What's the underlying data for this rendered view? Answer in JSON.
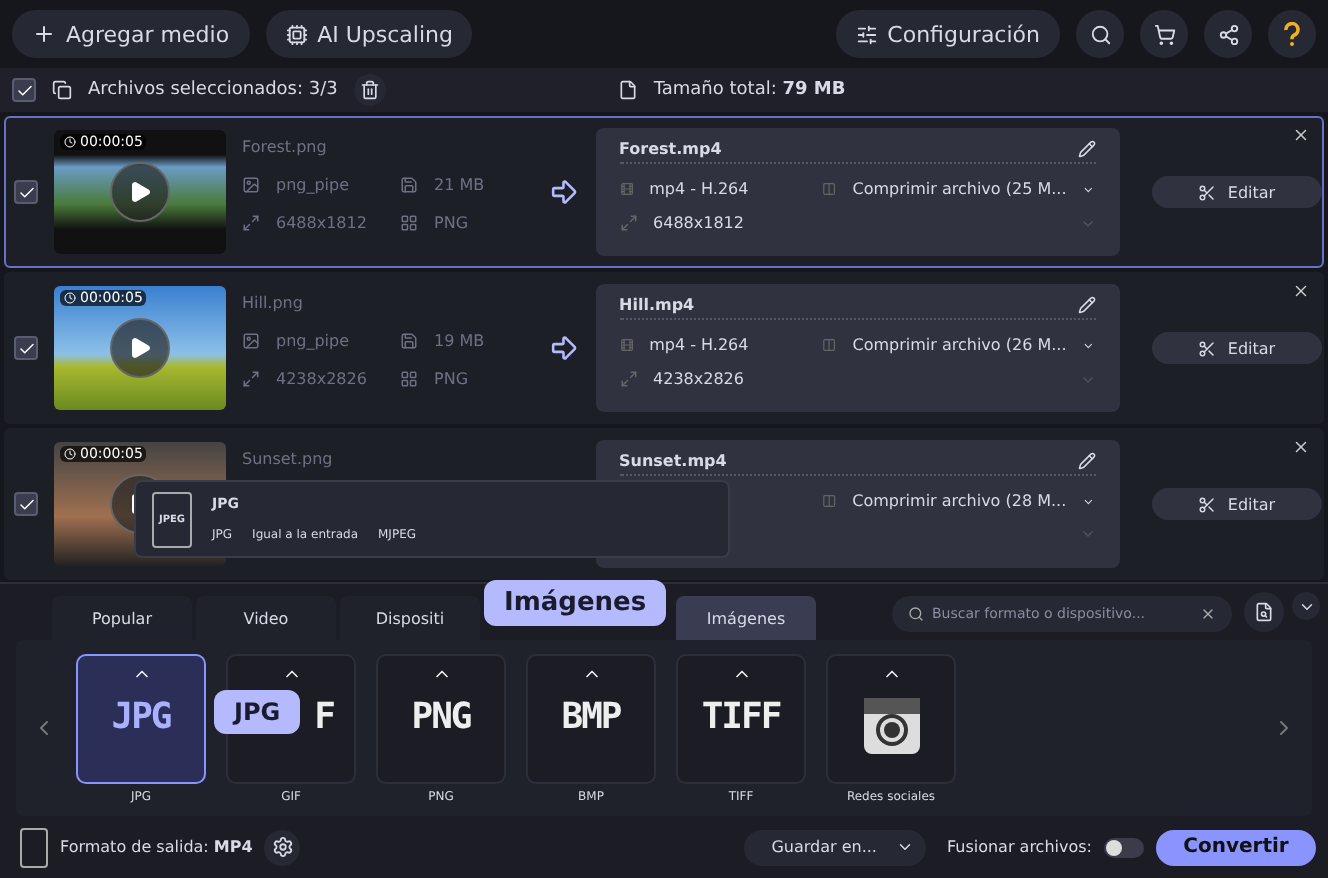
{
  "toolbar": {
    "add_button": "Agregar medio",
    "upscale_button": "AI Upscaling",
    "settings_button": "Configuración"
  },
  "selection_bar": {
    "checked": true,
    "selected_label": "Archivos seleccionados: 3/3",
    "total_size": "Tamaño total: **79 MB**"
  },
  "files": [
    {
      "checked": true,
      "duration": "00:00:05",
      "source_name": "Forest.png",
      "codec": "png_pipe",
      "size": "21 MB",
      "resolution": "6488x1812",
      "format": "PNG",
      "target_name": "Forest.mp4",
      "target_codec": "mp4 - H.264",
      "compression": "Comprimir archivo (25 M...",
      "target_resolution": "6488x1812",
      "edit_button": "Editar",
      "highlighted": true
    },
    {
      "checked": true,
      "duration": "00:00:05",
      "source_name": "Hill.png",
      "codec": "png_pipe",
      "size": "19 MB",
      "resolution": "4238x2826",
      "format": "PNG",
      "target_name": "Hill.mp4",
      "target_codec": "mp4 - H.264",
      "compression": "Comprimir archivo (26 M...",
      "target_resolution": "4238x2826",
      "edit_button": "Editar",
      "highlighted": false
    },
    {
      "checked": true,
      "duration": "00:00:05",
      "source_name": "Sunset.png",
      "target_name": "Sunset.mp4",
      "compression": "Comprimir archivo (28 M...",
      "edit_button": "Editar",
      "highlighted": false,
      "popup": {
        "icon_label": "JPEG",
        "title": "JPG",
        "details": [
          "JPG",
          "Igual a la entrada",
          "MJPEG"
        ]
      }
    }
  ],
  "format_tabs": [
    {
      "label": "Popular",
      "selected": false
    },
    {
      "label": "Video",
      "selected": false
    },
    {
      "label": "Dispositi",
      "selected": false
    },
    {
      "label": "Imágenes",
      "selected": true
    }
  ],
  "search": {
    "placeholder": "Buscar formato o dispositivo..."
  },
  "tab_callout": "Imágenes",
  "formats": [
    {
      "kind": "logo",
      "logo": "JPG",
      "label": "JPG",
      "selected": true,
      "callout": "JPG"
    },
    {
      "kind": "logo",
      "logo": "F",
      "label": "GIF",
      "selected": false
    },
    {
      "kind": "logo",
      "logo": "PNG",
      "label": "PNG",
      "selected": false
    },
    {
      "kind": "logo",
      "logo": "BMP",
      "label": "BMP",
      "selected": false
    },
    {
      "kind": "logo",
      "logo": "TIFF",
      "label": "TIFF",
      "selected": false
    },
    {
      "kind": "camera",
      "label": "Redes sociales",
      "selected": false
    }
  ],
  "footer": {
    "output_format": "Formato de salida: **MP4**",
    "save_button": "Guardar en...",
    "merge_label": "Fusionar archivos:",
    "merge_on": false,
    "convert_button": "Convertir"
  }
}
